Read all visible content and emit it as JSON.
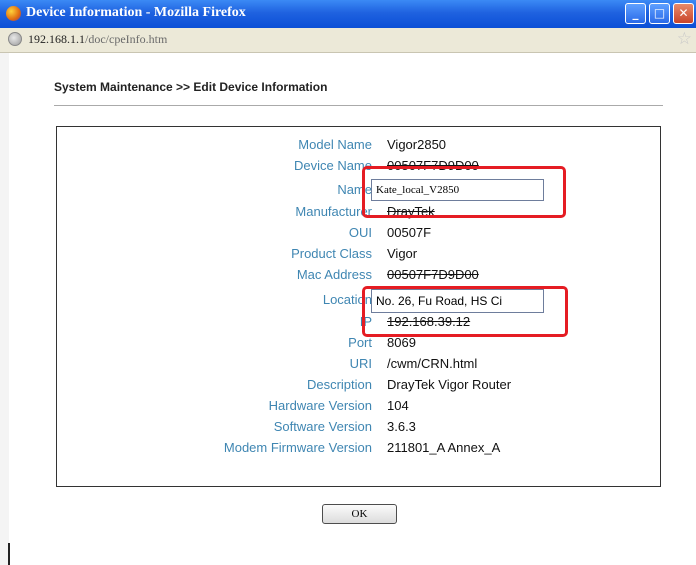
{
  "window": {
    "title": "Device Information - Mozilla Firefox",
    "url_host": "192.168.1.1",
    "url_path": "/doc/cpeInfo.htm"
  },
  "page": {
    "heading": "System Maintenance >> Edit Device Information"
  },
  "fields": [
    {
      "label": "Model Name",
      "value": "Vigor2850"
    },
    {
      "label": "Device Name",
      "value": "00507F7D9D00"
    },
    {
      "label": "Name",
      "value": "Kate_local_V2850"
    },
    {
      "label": "Manufacturer",
      "value": "DrayTek"
    },
    {
      "label": "OUI",
      "value": "00507F"
    },
    {
      "label": "Product Class",
      "value": "Vigor"
    },
    {
      "label": "Mac Address",
      "value": "00507F7D9D00"
    },
    {
      "label": "Location",
      "value": "No. 26, Fu Road, HS Ci"
    },
    {
      "label": "IP",
      "value": "192.168.39.12"
    },
    {
      "label": "Port",
      "value": "8069"
    },
    {
      "label": "URI",
      "value": "/cwm/CRN.html"
    },
    {
      "label": "Description",
      "value": "DrayTek Vigor Router"
    },
    {
      "label": "Hardware Version",
      "value": "104"
    },
    {
      "label": "Software Version",
      "value": "3.6.3"
    },
    {
      "label": "Modem Firmware Version",
      "value": "211801_A Annex_A"
    }
  ],
  "ok_label": "OK",
  "colors": {
    "label_blue": "#3f86b2",
    "highlight_red": "#e51c23",
    "titlebar_blue": "#1f62e0"
  },
  "icons": [
    "firefox-icon",
    "globe-icon",
    "bookmark-star-icon",
    "minimize-icon",
    "maximize-icon",
    "close-icon"
  ]
}
